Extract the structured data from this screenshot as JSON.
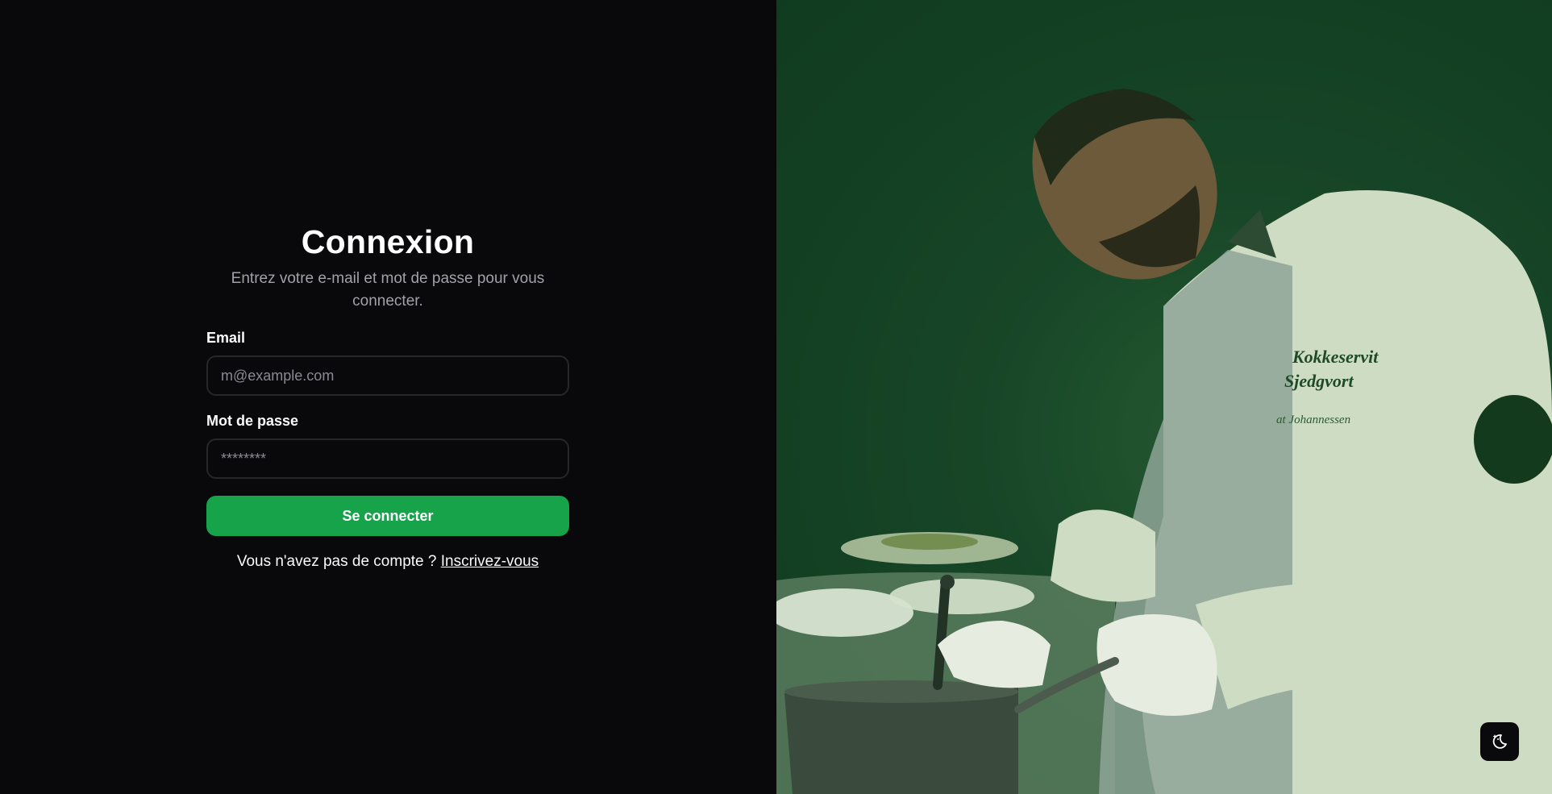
{
  "login": {
    "title": "Connexion",
    "subtitle": "Entrez votre e-mail et mot de passe pour vous connecter.",
    "email_label": "Email",
    "email_placeholder": "m@example.com",
    "password_label": "Mot de passe",
    "password_placeholder": "********",
    "submit_label": "Se connecter",
    "signup_prompt": "Vous n'avez pas de compte ?",
    "signup_link": "Inscrivez-vous"
  },
  "hero_image": {
    "description_icon": "chef-cooking-photo",
    "jacket_text_line1": "Kokkeservit",
    "jacket_text_line2": "Sjedgvort",
    "jacket_text_line3": "at Johannessen"
  },
  "theme_toggle": {
    "icon": "moon-stars-icon"
  },
  "colors": {
    "background": "#09090b",
    "accent": "#16a34a",
    "image_tint": "#1a4a2a"
  }
}
